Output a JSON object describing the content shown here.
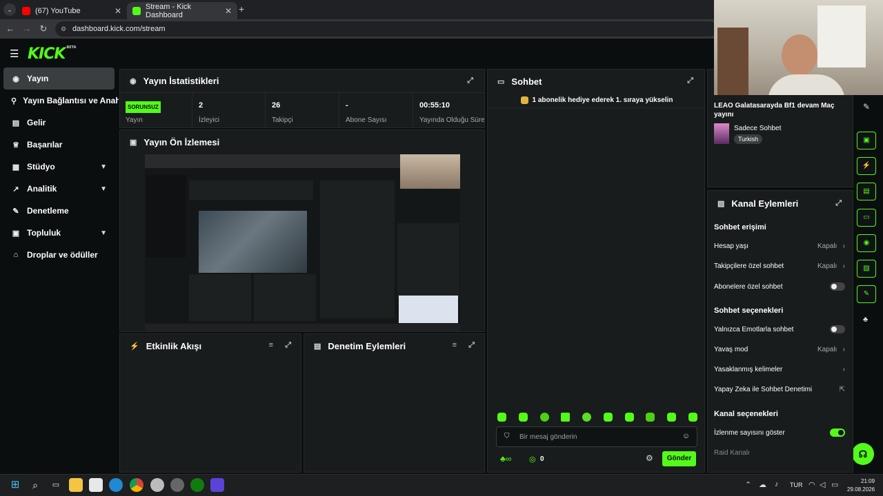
{
  "browser": {
    "tabs": [
      {
        "title": "(67) YouTube",
        "favicon": "youtube-icon",
        "active": false
      },
      {
        "title": "Stream - Kick Dashboard",
        "favicon": "kick-icon",
        "active": true
      }
    ],
    "url": "dashboard.kick.com/stream"
  },
  "brand": {
    "logo": "KICK",
    "badge": "BETA",
    "accent": "#53fc18"
  },
  "sidebar": {
    "items": [
      {
        "label": "Yayın",
        "icon": "stream-icon"
      },
      {
        "label": "Yayın Bağlantısı ve Anahtarı",
        "icon": "link-icon"
      },
      {
        "label": "Gelir",
        "icon": "revenue-icon"
      },
      {
        "label": "Başarılar",
        "icon": "trophy-icon"
      },
      {
        "label": "Stüdyo",
        "icon": "studio-icon"
      },
      {
        "label": "Analitik",
        "icon": "analytics-icon"
      },
      {
        "label": "Denetleme",
        "icon": "wrench-icon"
      },
      {
        "label": "Topluluk",
        "icon": "community-icon"
      },
      {
        "label": "Droplar ve ödüller",
        "icon": "gift-icon"
      }
    ]
  },
  "stats": {
    "title": "Yayın İstatistikleri",
    "status_badge": "SORUNSUZ",
    "status_label": "Yayın",
    "viewers_value": "2",
    "viewers_label": "İzleyici",
    "followers_value": "26",
    "followers_label": "Takipçi",
    "subs_value": "-",
    "subs_label": "Abone Sayısı",
    "uptime_value": "00:55:10",
    "uptime_label": "Yayında Olduğu Süre"
  },
  "preview": {
    "title": "Yayın Ön İzlemesi"
  },
  "activity": {
    "title": "Etkinlik Akışı"
  },
  "moderation": {
    "title": "Denetim Eylemleri"
  },
  "chat": {
    "title": "Sohbet",
    "pinned": "1 abonelik hediye ederek 1. sıraya yükselin",
    "input_placeholder": "Bir mesaj gönderin",
    "points": "0",
    "send_label": "Gönder"
  },
  "stream_info": {
    "title": "LEAO Galatasarayda Bf1 devam Maç yayını",
    "category": "Sadece Sohbet",
    "language_tag": "Turkish"
  },
  "channel_actions": {
    "title": "Kanal Eylemleri",
    "chat_access_heading": "Sohbet erişimi",
    "account_age_label": "Hesap yaşı",
    "account_age_value": "Kapalı",
    "followers_only_label": "Takipçilere özel sohbet",
    "followers_only_value": "Kapalı",
    "subs_only_label": "Abonelere özel sohbet",
    "chat_options_heading": "Sohbet seçenekleri",
    "emote_only_label": "Yalnızca Emotlarla sohbet",
    "slow_mode_label": "Yavaş mod",
    "slow_mode_value": "Kapalı",
    "banned_words_label": "Yasaklanmış kelimeler",
    "ai_mod_label": "Yapay Zeka ile Sohbet Denetimi",
    "channel_options_heading": "Kanal seçenekleri",
    "show_viewers_label": "İzlenme sayısını göster",
    "raid_label": "Raid Kanalı"
  },
  "taskbar": {
    "language": "TUR",
    "time": "21:09",
    "date": "29.08.2026"
  }
}
